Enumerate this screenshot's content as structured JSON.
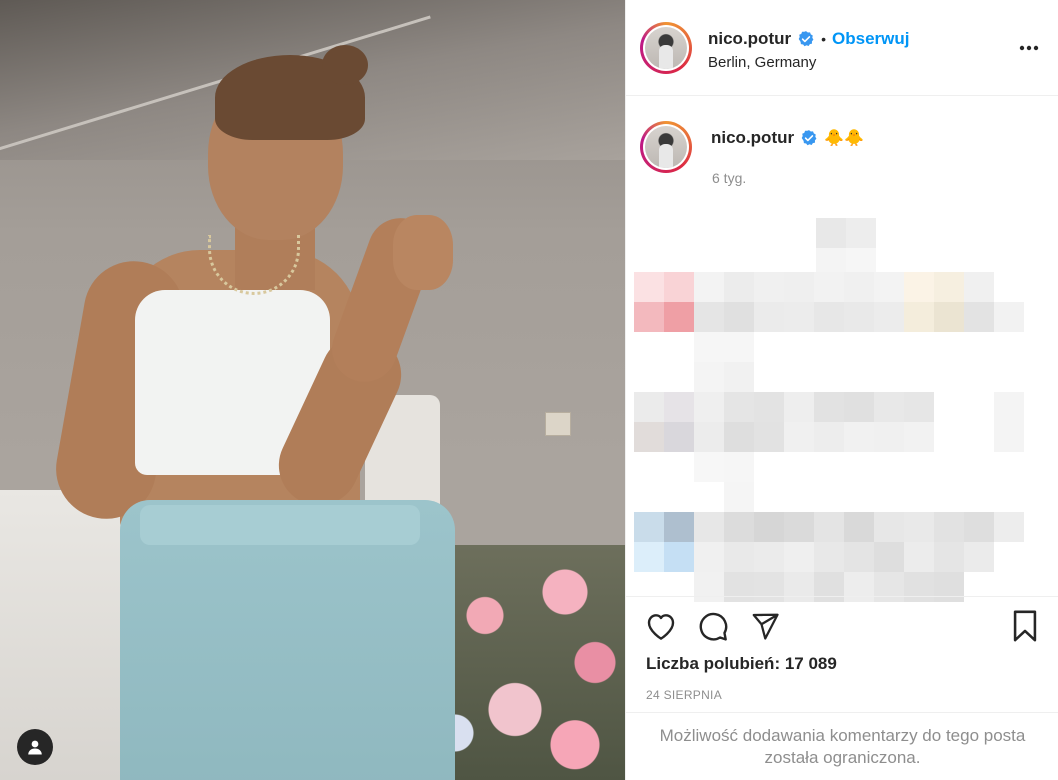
{
  "post": {
    "author": {
      "username": "nico.potur",
      "verified": true,
      "follow_label": "Obserwuj",
      "separator": "•",
      "location": "Berlin, Germany"
    },
    "caption": {
      "username": "nico.potur",
      "text": "🐥🐥",
      "time_ago": "6 tyg."
    },
    "likes": {
      "label": "Liczba polubień:",
      "count": "17 089"
    },
    "date": "24 SIERPNIA",
    "comments_disabled_text": "Możliwość dodawania komentarzy do tego posta została ograniczona."
  },
  "icons": {
    "more": "more-options-icon",
    "like": "heart-icon",
    "comment": "comment-icon",
    "share": "share-icon",
    "save": "bookmark-icon",
    "tag": "user-tag-icon",
    "verified": "verified-badge-icon"
  },
  "colors": {
    "accent": "#0095f6",
    "text": "#262626",
    "muted": "#8e8e8e",
    "border": "#efefef"
  }
}
